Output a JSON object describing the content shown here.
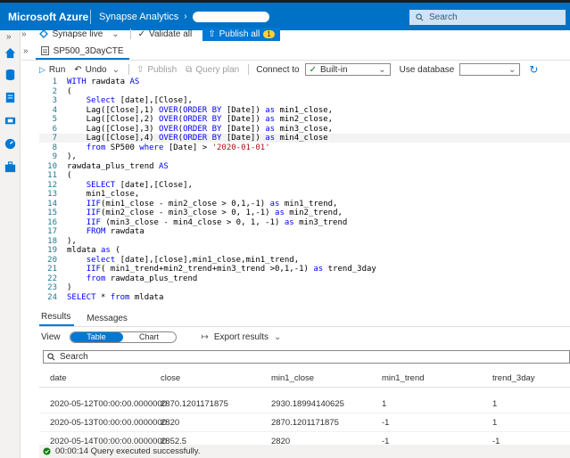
{
  "topbar": {
    "brand": "Microsoft Azure",
    "product": "Synapse Analytics",
    "search_placeholder": "Search"
  },
  "commandbar": {
    "synapse_live": "Synapse live",
    "validate_all": "Validate all",
    "publish_all": "Publish all",
    "publish_count": "1"
  },
  "tab": {
    "name": "SP500_3DayCTE"
  },
  "editor_toolbar": {
    "run": "Run",
    "undo": "Undo",
    "publish": "Publish",
    "query_plan": "Query plan",
    "connect_to_label": "Connect to",
    "connect_to_value": "Built-in",
    "use_database_label": "Use database"
  },
  "code_lines": [
    {
      "n": "1",
      "parts": [
        [
          "kw",
          "WITH "
        ],
        [
          "tx",
          "rawdata "
        ],
        [
          "kw",
          "AS"
        ]
      ]
    },
    {
      "n": "2",
      "parts": [
        [
          "tx",
          "("
        ]
      ]
    },
    {
      "n": "3",
      "parts": [
        [
          "tx",
          "    "
        ],
        [
          "kw",
          "Select "
        ],
        [
          "tx",
          "[date],[Close],"
        ]
      ]
    },
    {
      "n": "4",
      "parts": [
        [
          "tx",
          "    Lag([Close],1) "
        ],
        [
          "kw",
          "OVER"
        ],
        [
          "tx",
          "("
        ],
        [
          "kw",
          "ORDER BY "
        ],
        [
          "tx",
          "[Date]) "
        ],
        [
          "kw",
          "as "
        ],
        [
          "tx",
          "min1_close,"
        ]
      ]
    },
    {
      "n": "5",
      "parts": [
        [
          "tx",
          "    Lag([Close],2) "
        ],
        [
          "kw",
          "OVER"
        ],
        [
          "tx",
          "("
        ],
        [
          "kw",
          "ORDER BY "
        ],
        [
          "tx",
          "[Date]) "
        ],
        [
          "kw",
          "as "
        ],
        [
          "tx",
          "min2_close,"
        ]
      ]
    },
    {
      "n": "6",
      "parts": [
        [
          "tx",
          "    Lag([Close],3) "
        ],
        [
          "kw",
          "OVER"
        ],
        [
          "tx",
          "("
        ],
        [
          "kw",
          "ORDER BY "
        ],
        [
          "tx",
          "[Date]) "
        ],
        [
          "kw",
          "as "
        ],
        [
          "tx",
          "min3_close,"
        ]
      ]
    },
    {
      "n": "7",
      "parts": [
        [
          "tx",
          "    Lag([Close],4) "
        ],
        [
          "kw",
          "OVER"
        ],
        [
          "tx",
          "("
        ],
        [
          "kw",
          "ORDER BY "
        ],
        [
          "tx",
          "[Date]) "
        ],
        [
          "kw",
          "as "
        ],
        [
          "tx",
          "min4_close"
        ]
      ]
    },
    {
      "n": "8",
      "parts": [
        [
          "tx",
          "    "
        ],
        [
          "kw",
          "from "
        ],
        [
          "tx",
          "SP500 "
        ],
        [
          "kw",
          "where "
        ],
        [
          "tx",
          "[Date] > "
        ],
        [
          "str",
          "'2020-01-01'"
        ]
      ]
    },
    {
      "n": "9",
      "parts": [
        [
          "tx",
          "),"
        ]
      ]
    },
    {
      "n": "10",
      "parts": [
        [
          "tx",
          "rawdata_plus_trend "
        ],
        [
          "kw",
          "AS"
        ]
      ]
    },
    {
      "n": "11",
      "parts": [
        [
          "tx",
          "("
        ]
      ]
    },
    {
      "n": "12",
      "parts": [
        [
          "tx",
          "    "
        ],
        [
          "kw",
          "SELECT "
        ],
        [
          "tx",
          "[date],[Close],"
        ]
      ]
    },
    {
      "n": "13",
      "parts": [
        [
          "tx",
          "    min1_close,"
        ]
      ]
    },
    {
      "n": "14",
      "parts": [
        [
          "tx",
          "    "
        ],
        [
          "kw",
          "IIF"
        ],
        [
          "tx",
          "(min1_close - min2_close > 0,1,-1) "
        ],
        [
          "kw",
          "as "
        ],
        [
          "tx",
          "min1_trend,"
        ]
      ]
    },
    {
      "n": "15",
      "parts": [
        [
          "tx",
          "    "
        ],
        [
          "kw",
          "IIF"
        ],
        [
          "tx",
          "(min2_close - min3_close > 0, 1,-1) "
        ],
        [
          "kw",
          "as "
        ],
        [
          "tx",
          "min2_trend,"
        ]
      ]
    },
    {
      "n": "16",
      "parts": [
        [
          "tx",
          "    "
        ],
        [
          "kw",
          "IIF "
        ],
        [
          "tx",
          "(min3_close - min4_close > 0, 1, -1) "
        ],
        [
          "kw",
          "as "
        ],
        [
          "tx",
          "min3_trend"
        ]
      ]
    },
    {
      "n": "17",
      "parts": [
        [
          "tx",
          "    "
        ],
        [
          "kw",
          "FROM "
        ],
        [
          "tx",
          "rawdata"
        ]
      ]
    },
    {
      "n": "18",
      "parts": [
        [
          "tx",
          "),"
        ]
      ]
    },
    {
      "n": "19",
      "parts": [
        [
          "tx",
          "mldata "
        ],
        [
          "kw",
          "as "
        ],
        [
          "tx",
          "("
        ]
      ]
    },
    {
      "n": "20",
      "parts": [
        [
          "tx",
          "    "
        ],
        [
          "kw",
          "select "
        ],
        [
          "tx",
          "[date],[close],min1_close,min1_trend,"
        ]
      ]
    },
    {
      "n": "21",
      "parts": [
        [
          "tx",
          "    "
        ],
        [
          "kw",
          "IIF"
        ],
        [
          "tx",
          "( min1_trend+min2_trend+min3_trend >0,1,-1) "
        ],
        [
          "kw",
          "as "
        ],
        [
          "tx",
          "trend_3day"
        ]
      ]
    },
    {
      "n": "22",
      "parts": [
        [
          "tx",
          "    "
        ],
        [
          "kw",
          "from "
        ],
        [
          "tx",
          "rawdata_plus_trend"
        ]
      ]
    },
    {
      "n": "23",
      "parts": [
        [
          "tx",
          ")"
        ]
      ]
    },
    {
      "n": "24",
      "parts": [
        [
          "kw",
          "SELECT "
        ],
        [
          "tx",
          "* "
        ],
        [
          "kw",
          "from "
        ],
        [
          "tx",
          "mldata"
        ]
      ]
    }
  ],
  "results": {
    "tab_results": "Results",
    "tab_messages": "Messages",
    "view_label": "View",
    "view_table": "Table",
    "view_chart": "Chart",
    "export": "Export results",
    "search_placeholder": "Search",
    "columns": [
      "date",
      "close",
      "min1_close",
      "min1_trend",
      "trend_3day"
    ],
    "rows": [
      [
        "2020-05-12T00:00:00.0000000",
        "2870.1201171875",
        "2930.18994140625",
        "1",
        "1"
      ],
      [
        "2020-05-13T00:00:00.0000000",
        "2820",
        "2870.1201171875",
        "-1",
        "1"
      ],
      [
        "2020-05-14T00:00:00.0000000",
        "2852.5",
        "2820",
        "-1",
        "-1"
      ]
    ],
    "status": "00:00:14 Query executed successfully."
  }
}
